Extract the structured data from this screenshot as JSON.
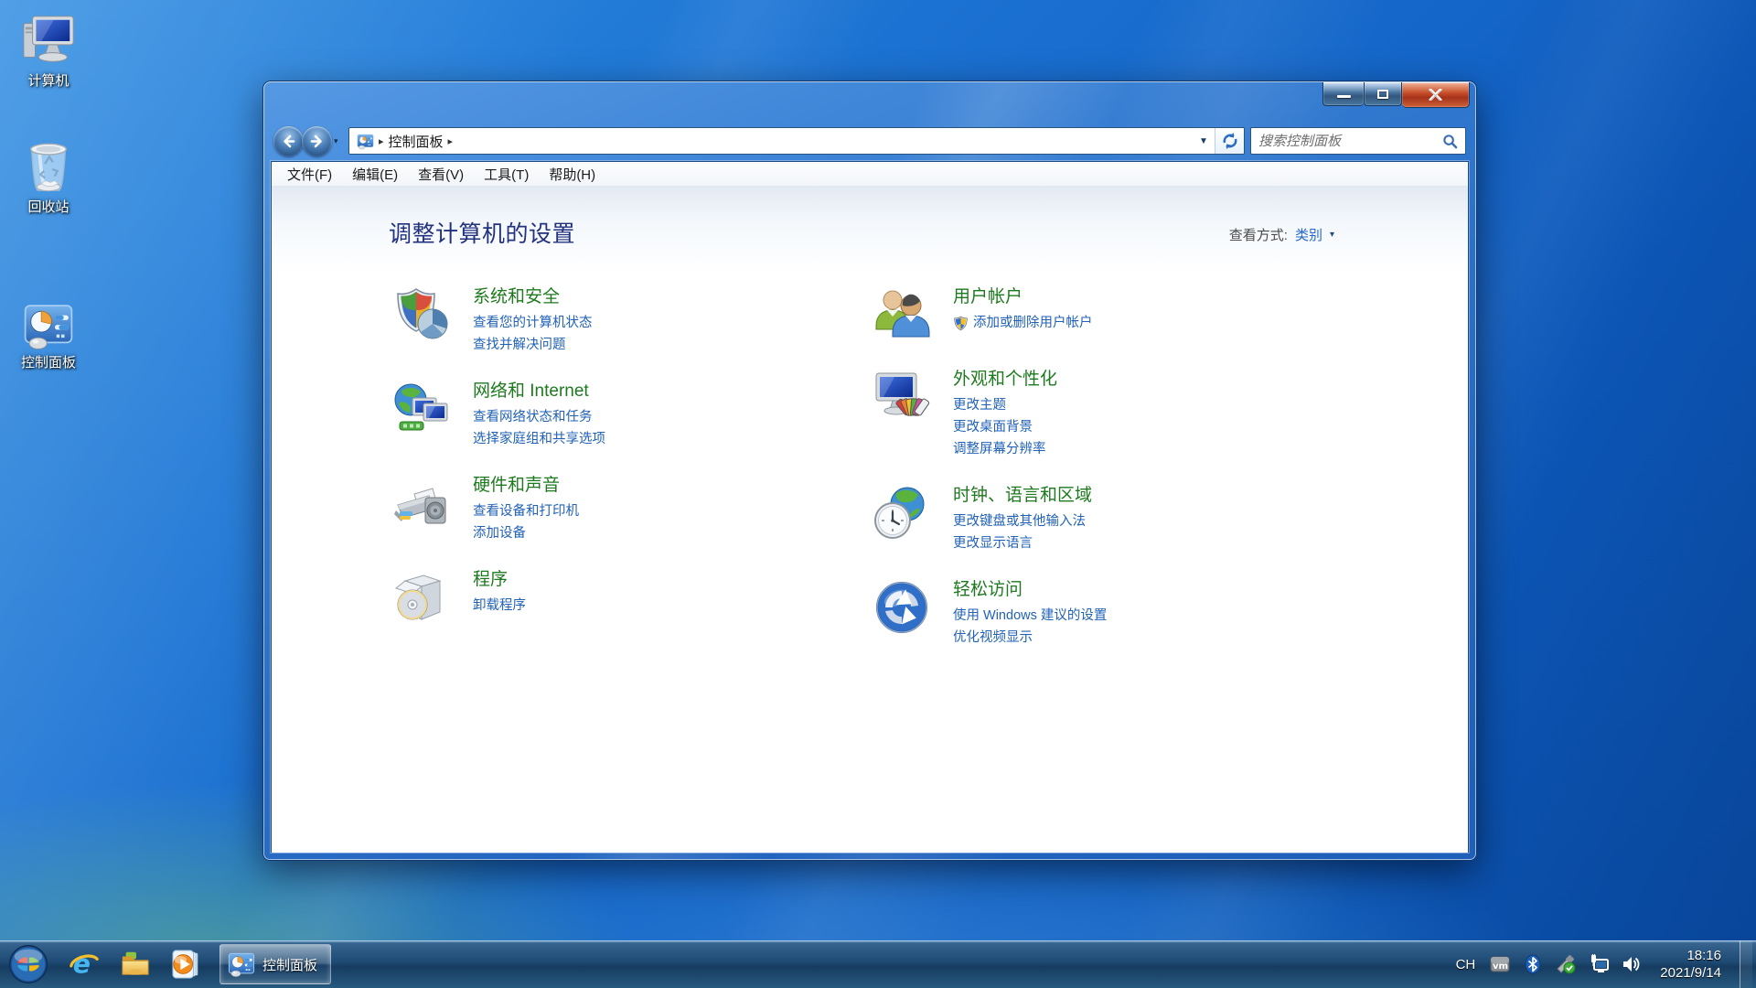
{
  "desktop": {
    "icons": [
      {
        "label": "计算机"
      },
      {
        "label": "回收站"
      },
      {
        "label": "控制面板"
      }
    ]
  },
  "window": {
    "breadcrumb": {
      "location": "控制面板"
    },
    "search": {
      "placeholder": "搜索控制面板"
    },
    "menu": {
      "items": [
        "文件(F)",
        "编辑(E)",
        "查看(V)",
        "工具(T)",
        "帮助(H)"
      ]
    },
    "header": {
      "title": "调整计算机的设置",
      "view_by_label": "查看方式:",
      "view_by_value": "类别"
    },
    "categories": {
      "left": [
        {
          "title": "系统和安全",
          "links": [
            {
              "text": "查看您的计算机状态"
            },
            {
              "text": "查找并解决问题"
            }
          ]
        },
        {
          "title": "网络和 Internet",
          "links": [
            {
              "text": "查看网络状态和任务"
            },
            {
              "text": "选择家庭组和共享选项"
            }
          ]
        },
        {
          "title": "硬件和声音",
          "links": [
            {
              "text": "查看设备和打印机"
            },
            {
              "text": "添加设备"
            }
          ]
        },
        {
          "title": "程序",
          "links": [
            {
              "text": "卸载程序"
            }
          ]
        }
      ],
      "right": [
        {
          "title": "用户帐户",
          "links": [
            {
              "text": "添加或删除用户帐户"
            }
          ]
        },
        {
          "title": "外观和个性化",
          "links": [
            {
              "text": "更改主题"
            },
            {
              "text": "更改桌面背景"
            },
            {
              "text": "调整屏幕分辨率"
            }
          ]
        },
        {
          "title": "时钟、语言和区域",
          "links": [
            {
              "text": "更改键盘或其他输入法"
            },
            {
              "text": "更改显示语言"
            }
          ]
        },
        {
          "title": "轻松访问",
          "links": [
            {
              "text": "使用 Windows 建议的设置"
            },
            {
              "text": "优化视频显示"
            }
          ]
        }
      ]
    }
  },
  "taskbar": {
    "task_button_label": "控制面板",
    "tray": {
      "language": "CH",
      "time": "18:16",
      "date": "2021/9/14"
    }
  },
  "icons": {
    "breadcrumb_arrow": "▸",
    "address_dropdown": "▼",
    "history_dropdown": "▾",
    "view_dropdown": "▾"
  },
  "colors": {
    "category_green": "#1e7a1e",
    "link_blue": "#2162b8",
    "title_navy": "#21317e",
    "close_red": "#c44b28"
  }
}
